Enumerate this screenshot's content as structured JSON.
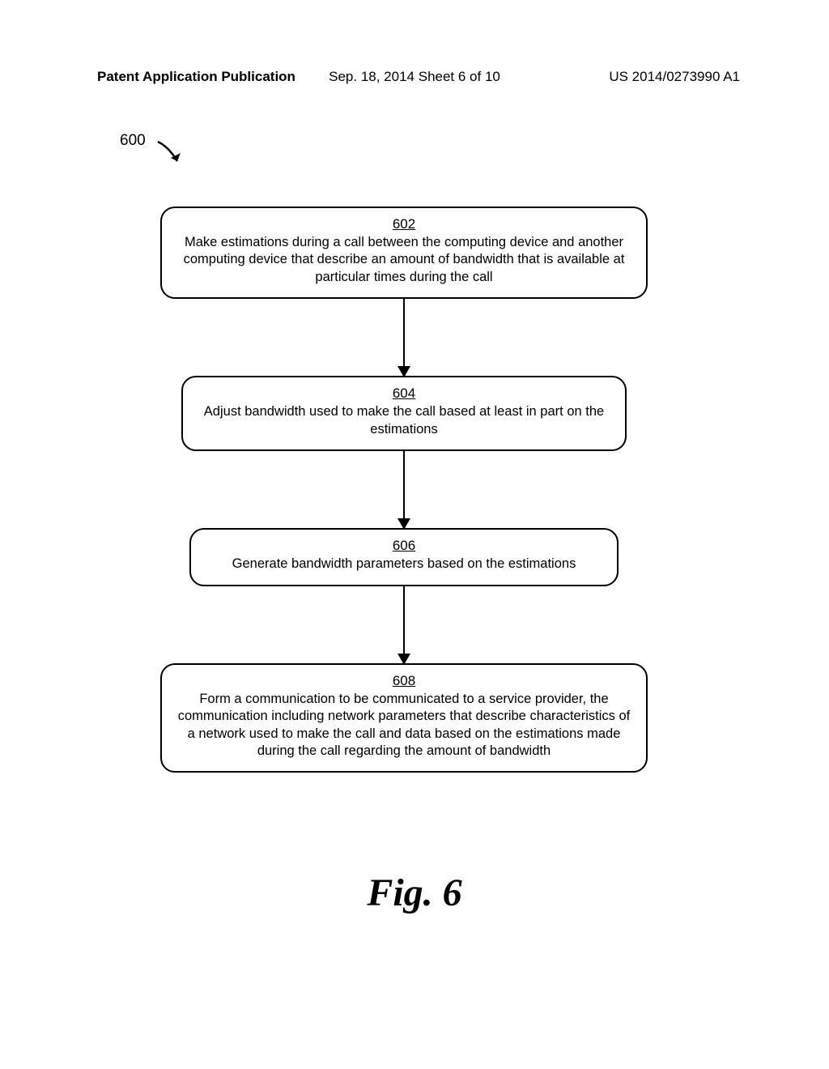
{
  "header": {
    "left": "Patent Application Publication",
    "center": "Sep. 18, 2014  Sheet 6 of 10",
    "right": "US 2014/0273990 A1"
  },
  "figure_ref": "600",
  "steps": {
    "s602": {
      "num": "602",
      "text": "Make estimations during a call between the computing device and another computing device that describe an amount of bandwidth that is available at particular times during the call"
    },
    "s604": {
      "num": "604",
      "text": "Adjust bandwidth used to make the call based at least in part on the estimations"
    },
    "s606": {
      "num": "606",
      "text": "Generate bandwidth parameters based on the estimations"
    },
    "s608": {
      "num": "608",
      "text": "Form a communication to be communicated to a service provider, the communication including network parameters that describe characteristics of a network used to make the call and data based on the estimations made during the call regarding the amount of bandwidth"
    }
  },
  "figure_label": "Fig. 6"
}
